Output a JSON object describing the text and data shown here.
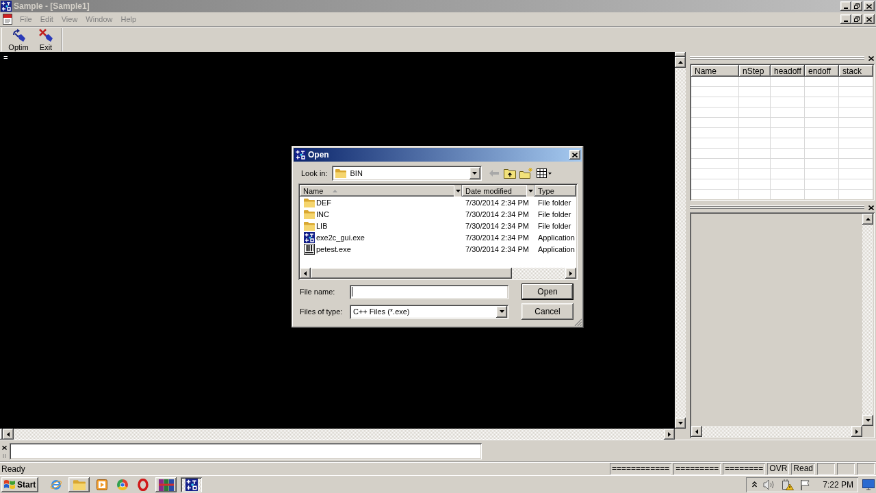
{
  "window": {
    "title": "Sample - [Sample1]"
  },
  "menu": [
    {
      "label": "File",
      "disabled": true
    },
    {
      "label": "Edit",
      "disabled": true
    },
    {
      "label": "View",
      "disabled": true
    },
    {
      "label": "Window",
      "disabled": true
    },
    {
      "label": "Help",
      "disabled": true
    }
  ],
  "toolbar": [
    {
      "label": "Optim",
      "kind": "arrow"
    },
    {
      "label": "Exit",
      "kind": "cross"
    }
  ],
  "console": {
    "text": "="
  },
  "functions_table": {
    "columns": [
      "Name",
      "nStep",
      "headoff",
      "endoff",
      "stack"
    ]
  },
  "status_bar": {
    "message": "Ready",
    "panes": [
      "============",
      "=========",
      "========",
      "OVR",
      "Read"
    ]
  },
  "taskbar": {
    "start": "Start",
    "items": [
      {
        "kind": "globe",
        "running": false,
        "selected": false
      },
      {
        "kind": "folder",
        "running": true,
        "selected": false
      },
      {
        "kind": "player",
        "running": false,
        "selected": false
      },
      {
        "kind": "circle",
        "running": false,
        "selected": false
      },
      {
        "kind": "ring",
        "running": false,
        "selected": false
      },
      {
        "kind": "books",
        "running": true,
        "selected": false
      },
      {
        "kind": "app",
        "running": true,
        "selected": true
      }
    ],
    "clock": "7:22 PM"
  },
  "open_dialog": {
    "title": "Open",
    "look_in": {
      "label": "Look in:",
      "value": "BIN"
    },
    "nav": [
      {
        "kind": "back",
        "disabled": true
      },
      {
        "kind": "up",
        "disabled": false
      },
      {
        "kind": "new_folder",
        "disabled": false
      },
      {
        "kind": "views",
        "disabled": false
      }
    ],
    "columns": [
      {
        "label": "Name",
        "sorted": true
      },
      {
        "label": "Date modified",
        "sorted": false
      },
      {
        "label": "Type",
        "sorted": false
      }
    ],
    "files": [
      {
        "kind": "folder",
        "name": "DEF",
        "date": "7/30/2014 2:34 PM",
        "type": "File folder"
      },
      {
        "kind": "folder",
        "name": "INC",
        "date": "7/30/2014 2:34 PM",
        "type": "File folder"
      },
      {
        "kind": "folder",
        "name": "LIB",
        "date": "7/30/2014 2:34 PM",
        "type": "File folder"
      },
      {
        "kind": "diagram_app",
        "name": "exe2c_gui.exe",
        "date": "7/30/2014 2:34 PM",
        "type": "Application"
      },
      {
        "kind": "plain_app",
        "name": "petest.exe",
        "date": "7/30/2014 2:34 PM",
        "type": "Application"
      }
    ],
    "file_name": {
      "label": "File name:"
    },
    "file_type": {
      "label": "Files of type:",
      "value": "C++ Files (*.exe)"
    },
    "buttons": [
      {
        "label": "Open",
        "default": true
      },
      {
        "label": "Cancel",
        "default": false
      }
    ]
  }
}
